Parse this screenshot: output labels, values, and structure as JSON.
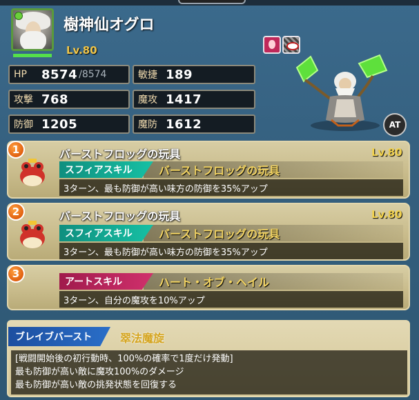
{
  "unit": {
    "name": "樹神仙オグロ",
    "level": "Lv.80",
    "hp_fill": 1.0
  },
  "stats": {
    "hp": {
      "label": "HP",
      "value": "8574",
      "max": "/8574"
    },
    "agility": {
      "label": "敏捷",
      "value": "189"
    },
    "attack": {
      "label": "攻撃",
      "value": "768"
    },
    "magic_attack": {
      "label": "魔攻",
      "value": "1417"
    },
    "defense": {
      "label": "防御",
      "value": "1205"
    },
    "magic_defense": {
      "label": "魔防",
      "value": "1612"
    }
  },
  "at_button": "AT",
  "skills": [
    {
      "number": "1",
      "name": "バーストフロッグの玩具",
      "level": "Lv.80",
      "type": "スフィアスキル",
      "skill_name": "バーストフロッグの玩具",
      "description": "3ターン、最も防御が高い味方の防御を35%アップ"
    },
    {
      "number": "2",
      "name": "バーストフロッグの玩具",
      "level": "Lv.80",
      "type": "スフィアスキル",
      "skill_name": "バーストフロッグの玩具",
      "description": "3ターン、最も防御が高い味方の防御を35%アップ"
    },
    {
      "number": "3",
      "type": "アートスキル",
      "skill_name": "ハート・オブ・ヘイル",
      "description": "3ターン、自分の魔攻を10%アップ"
    }
  ],
  "brave_burst": {
    "label": "ブレイブバースト",
    "name": "翠法魔旋",
    "lines": [
      "[戦闘開始後の初行動時、100%の確率で1度だけ発動]",
      "最も防御が高い敵に魔攻100%のダメージ",
      "最も防御が高い敵の挑発状態を回復する"
    ]
  },
  "colors": {
    "level_gold": "#f0c64a",
    "sphere_tag": "#17c0a4",
    "art_tag": "#d0306c",
    "brave_tag": "#2a6ec8"
  }
}
